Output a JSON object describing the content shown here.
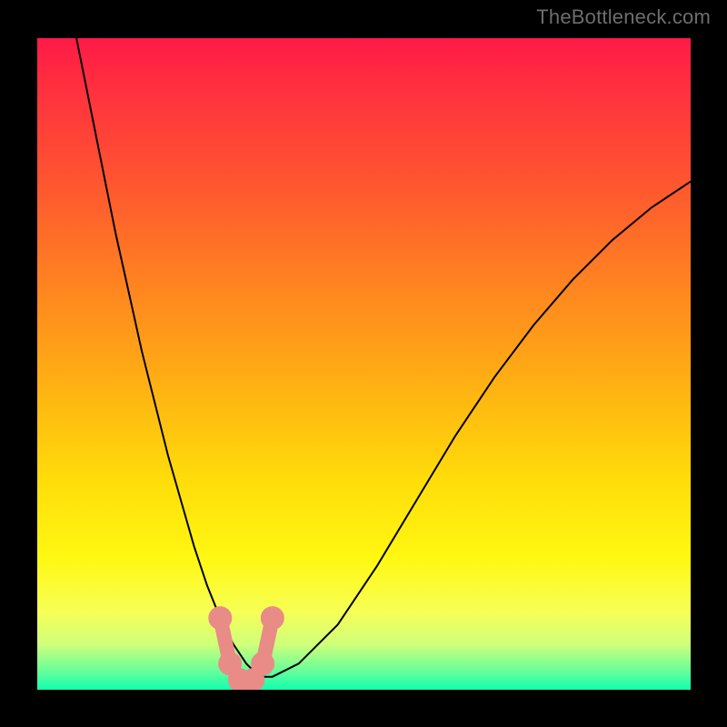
{
  "watermark": "TheBottleneck.com",
  "chart_data": {
    "type": "line",
    "title": "",
    "xlabel": "",
    "ylabel": "",
    "xlim": [
      0,
      100
    ],
    "ylim": [
      0,
      100
    ],
    "series": [
      {
        "name": "bottleneck-curve",
        "x": [
          6,
          8,
          10,
          12,
          14,
          16,
          18,
          20,
          22,
          24,
          26,
          28,
          30,
          32,
          34,
          36,
          40,
          46,
          52,
          58,
          64,
          70,
          76,
          82,
          88,
          94,
          100
        ],
        "y": [
          100,
          90,
          80,
          70,
          61,
          52,
          44,
          36,
          29,
          22,
          16,
          11,
          7,
          4,
          2,
          2,
          4,
          10,
          19,
          29,
          39,
          48,
          56,
          63,
          69,
          74,
          78
        ]
      }
    ],
    "touch_region": {
      "x_range": [
        28,
        36
      ],
      "y_range": [
        0,
        11
      ]
    }
  },
  "gradient_stops": [
    {
      "pct": 0,
      "color": "#ff1a47"
    },
    {
      "pct": 80,
      "color": "#fff812"
    },
    {
      "pct": 100,
      "color": "#12ffb0"
    }
  ]
}
